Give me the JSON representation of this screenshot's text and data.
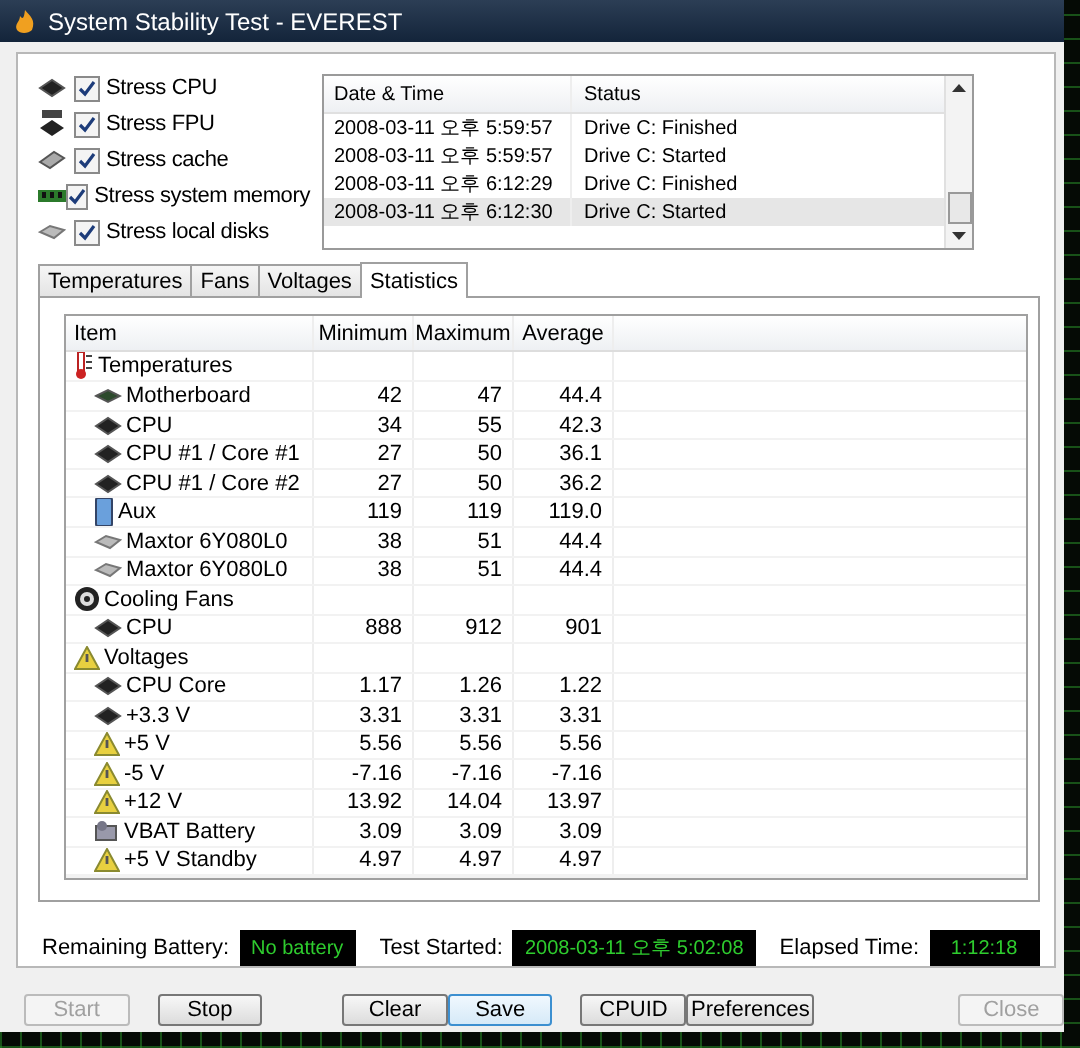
{
  "window": {
    "title": "System Stability Test - EVEREST"
  },
  "stress_options": [
    {
      "kind": "cpu",
      "label": "Stress CPU",
      "checked": true
    },
    {
      "kind": "fpu",
      "label": "Stress FPU",
      "checked": true
    },
    {
      "kind": "cache",
      "label": "Stress cache",
      "checked": true
    },
    {
      "kind": "memory",
      "label": "Stress system memory",
      "checked": true
    },
    {
      "kind": "disk",
      "label": "Stress local disks",
      "checked": true
    }
  ],
  "log": {
    "columns": [
      "Date & Time",
      "Status"
    ],
    "rows": [
      {
        "time": "2008-03-11 오후 5:59:57",
        "status": "Drive C: Finished",
        "selected": false
      },
      {
        "time": "2008-03-11 오후 5:59:57",
        "status": "Drive C: Started",
        "selected": false
      },
      {
        "time": "2008-03-11 오후 6:12:29",
        "status": "Drive C: Finished",
        "selected": false
      },
      {
        "time": "2008-03-11 오후 6:12:30",
        "status": "Drive C: Started",
        "selected": true
      }
    ]
  },
  "tabs": [
    {
      "label": "Temperatures",
      "selected": false
    },
    {
      "label": "Fans",
      "selected": false
    },
    {
      "label": "Voltages",
      "selected": false
    },
    {
      "label": "Statistics",
      "selected": true
    }
  ],
  "statistics": {
    "columns": [
      "Item",
      "Minimum",
      "Maximum",
      "Average"
    ],
    "rows": [
      {
        "kind": "thermometer",
        "item": "Temperatures",
        "children": [
          {
            "kind": "board",
            "item": "Motherboard",
            "min": "42",
            "max": "47",
            "avg": "44.4"
          },
          {
            "kind": "chip",
            "item": "CPU",
            "min": "34",
            "max": "55",
            "avg": "42.3"
          },
          {
            "kind": "chip",
            "item": "CPU #1 / Core #1",
            "min": "27",
            "max": "50",
            "avg": "36.1"
          },
          {
            "kind": "chip",
            "item": "CPU #1 / Core #2",
            "min": "27",
            "max": "50",
            "avg": "36.2"
          },
          {
            "kind": "pc",
            "item": "Aux",
            "min": "119",
            "max": "119",
            "avg": "119.0"
          },
          {
            "kind": "drive",
            "item": "Maxtor 6Y080L0",
            "min": "38",
            "max": "51",
            "avg": "44.4"
          },
          {
            "kind": "drive",
            "item": "Maxtor 6Y080L0",
            "min": "38",
            "max": "51",
            "avg": "44.4"
          }
        ]
      },
      {
        "kind": "fan",
        "item": "Cooling Fans",
        "children": [
          {
            "kind": "chip",
            "item": "CPU",
            "min": "888",
            "max": "912",
            "avg": "901"
          }
        ]
      },
      {
        "kind": "warning",
        "item": "Voltages",
        "children": [
          {
            "kind": "chip",
            "item": "CPU Core",
            "min": "1.17",
            "max": "1.26",
            "avg": "1.22"
          },
          {
            "kind": "chip",
            "item": "+3.3 V",
            "min": "3.31",
            "max": "3.31",
            "avg": "3.31"
          },
          {
            "kind": "warning",
            "item": "+5 V",
            "min": "5.56",
            "max": "5.56",
            "avg": "5.56"
          },
          {
            "kind": "warning",
            "item": "-5 V",
            "min": "-7.16",
            "max": "-7.16",
            "avg": "-7.16"
          },
          {
            "kind": "warning",
            "item": "+12 V",
            "min": "13.92",
            "max": "14.04",
            "avg": "13.97"
          },
          {
            "kind": "battery",
            "item": "VBAT Battery",
            "min": "3.09",
            "max": "3.09",
            "avg": "3.09"
          },
          {
            "kind": "warning",
            "item": "+5 V Standby",
            "min": "4.97",
            "max": "4.97",
            "avg": "4.97"
          }
        ]
      }
    ]
  },
  "status": [
    {
      "label": "Remaining Battery:",
      "value": "No battery"
    },
    {
      "label": "Test Started:",
      "value": "2008-03-11 오후 5:02:08"
    },
    {
      "label": "Elapsed Time:",
      "value": "1:12:18"
    }
  ],
  "buttons": [
    {
      "label": "Start",
      "disabled": true,
      "focused": false
    },
    {
      "label": "Stop",
      "disabled": false,
      "focused": false
    },
    {
      "label": "Clear",
      "disabled": false,
      "focused": false
    },
    {
      "label": "Save",
      "disabled": false,
      "focused": true
    },
    {
      "label": "CPUID",
      "disabled": false,
      "focused": false
    },
    {
      "label": "Preferences",
      "disabled": false,
      "focused": false
    },
    {
      "label": "Close",
      "disabled": true,
      "focused": false
    }
  ]
}
